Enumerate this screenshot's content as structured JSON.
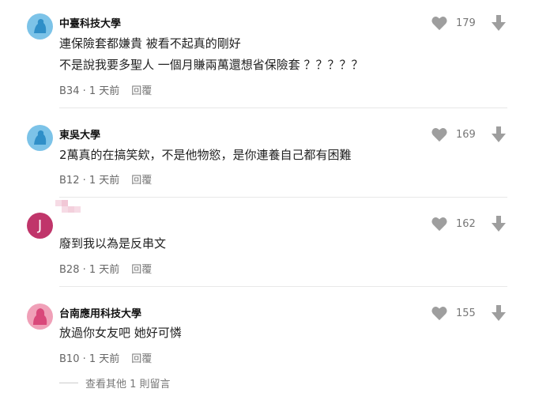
{
  "comments": [
    {
      "author": "中臺科技大學",
      "avatar": "school-avatar-icon",
      "lines": [
        "連保險套都嫌貴 被看不起真的剛好",
        "不是說我要多聖人  一個月賺兩萬還想省保險套 ？？？？？"
      ],
      "floor": "B34",
      "time": "1 天前",
      "reply": "回覆",
      "likes": "179"
    },
    {
      "author": "東吳大學",
      "avatar": "school-avatar-icon",
      "lines": [
        "2萬真的在搞笑欸，不是他物慾，是你連養自己都有困難"
      ],
      "floor": "B12",
      "time": "1 天前",
      "reply": "回覆",
      "likes": "169"
    },
    {
      "author": "",
      "avatar": "J",
      "lines": [
        "廢到我以為是反串文"
      ],
      "floor": "B28",
      "time": "1 天前",
      "reply": "回覆",
      "likes": "162"
    },
    {
      "author": "台南應用科技大學",
      "avatar": "female-avatar-icon",
      "lines": [
        "放過你女友吧 她好可憐"
      ],
      "floor": "B10",
      "time": "1 天前",
      "reply": "回覆",
      "likes": "155"
    }
  ],
  "more_replies": "查看其他 1 則留言",
  "colors": {
    "school_avatar": "#7cc3e8",
    "letter_avatar": "#c0356a",
    "female_avatar": "#f0a0b8",
    "icon_gray": "#9e9e9e"
  }
}
